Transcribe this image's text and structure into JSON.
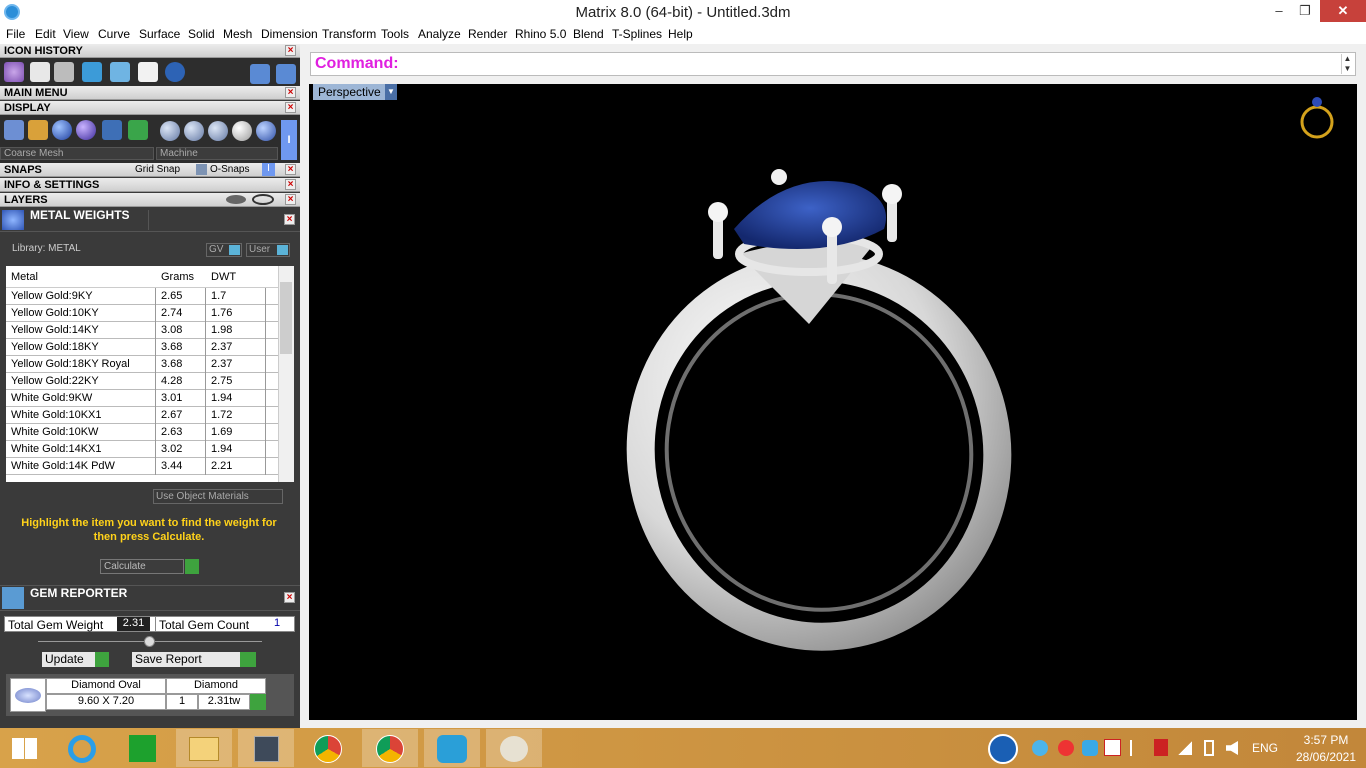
{
  "window": {
    "title": "Matrix 8.0 (64-bit) - Untitled.3dm",
    "min": "–",
    "max": "❐",
    "close": "✕"
  },
  "menu": [
    "File",
    "Edit",
    "View",
    "Curve",
    "Surface",
    "Solid",
    "Mesh",
    "Dimension",
    "Transform",
    "Tools",
    "Analyze",
    "Render",
    "Rhino 5.0",
    "Blend",
    "T-Splines",
    "Help"
  ],
  "panels": {
    "icon_history": "ICON HISTORY",
    "main_menu": "MAIN MENU",
    "display": "DISPLAY",
    "snaps": "SNAPS",
    "info_settings": "INFO & SETTINGS",
    "layers": "LAYERS",
    "close": "×"
  },
  "display": {
    "mesh_select": "Coarse Mesh",
    "render_select": "Machine",
    "indicator": "I"
  },
  "snaps": {
    "grid": "Grid Snap",
    "osnap": "O-Snaps"
  },
  "metal_weights": {
    "title": "METAL WEIGHTS",
    "library": "Library: METAL",
    "gv": "GV",
    "user": "User",
    "columns": [
      "Metal",
      "Grams",
      "DWT"
    ],
    "rows": [
      [
        "Yellow Gold:9KY",
        "2.65",
        "1.7"
      ],
      [
        "Yellow Gold:10KY",
        "2.74",
        "1.76"
      ],
      [
        "Yellow Gold:14KY",
        "3.08",
        "1.98"
      ],
      [
        "Yellow Gold:18KY",
        "3.68",
        "2.37"
      ],
      [
        "Yellow Gold:18KY Royal",
        "3.68",
        "2.37"
      ],
      [
        "Yellow Gold:22KY",
        "4.28",
        "2.75"
      ],
      [
        "White Gold:9KW",
        "3.01",
        "1.94"
      ],
      [
        "White Gold:10KX1",
        "2.67",
        "1.72"
      ],
      [
        "White Gold:10KW",
        "2.63",
        "1.69"
      ],
      [
        "White Gold:14KX1",
        "3.02",
        "1.94"
      ],
      [
        "White Gold:14K PdW",
        "3.44",
        "2.21"
      ]
    ],
    "use_object": "Use Object Materials",
    "hint": "Highlight the item you want to find the weight for then press Calculate.",
    "calculate": "Calculate"
  },
  "gem_reporter": {
    "title": "GEM REPORTER",
    "total_weight_label": "Total Gem Weight",
    "total_weight": "2.31",
    "total_count_label": "Total Gem Count",
    "total_count": "1",
    "update": "Update",
    "save_report": "Save Report",
    "gem_name": "Diamond Oval",
    "gem_type": "Diamond",
    "gem_size": "9.60 X 7.20",
    "gem_qty": "1",
    "gem_weight": "2.31tw"
  },
  "command": {
    "label": "Command:"
  },
  "viewport": {
    "name": "Perspective"
  },
  "tray": {
    "lang": "ENG",
    "time": "3:57 PM",
    "date": "28/06/2021"
  },
  "colors": {
    "command": "#e020e0",
    "hint": "#ffd21a",
    "stone": "#1c3a9a"
  }
}
